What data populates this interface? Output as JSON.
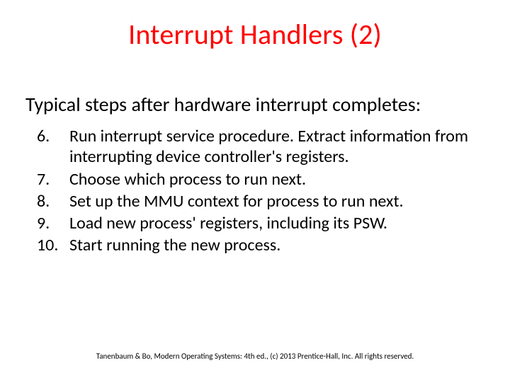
{
  "title": "Interrupt Handlers (2)",
  "subheading": "Typical steps after hardware interrupt completes:",
  "items": [
    {
      "num": "6.",
      "text": "Run interrupt service procedure.  Extract information from interrupting device controller's registers."
    },
    {
      "num": "7.",
      "text": "Choose which process to run next."
    },
    {
      "num": "8.",
      "text": "Set up the MMU context for process to run next."
    },
    {
      "num": "9.",
      "text": "Load new process' registers, including its PSW."
    },
    {
      "num": "10.",
      "text": "Start running the new process."
    }
  ],
  "footer": "Tanenbaum & Bo, Modern Operating Systems: 4th ed., (c) 2013 Prentice-Hall, Inc. All rights reserved."
}
